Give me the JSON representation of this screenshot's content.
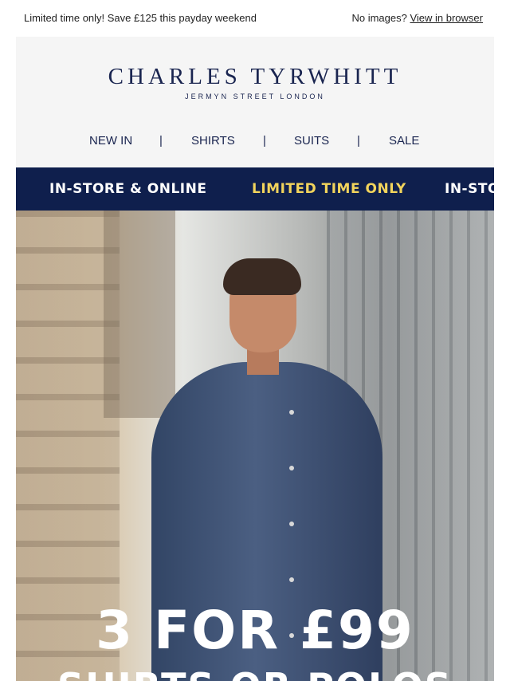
{
  "preheader": {
    "promo_text": "Limited time only! Save £125 this payday weekend",
    "no_images_text": "No images?",
    "view_in_browser_link": "View in browser"
  },
  "header": {
    "brand_name": "CHARLES TYRWHITT",
    "brand_tagline": "JERMYN STREET LONDON",
    "nav": {
      "items": [
        "NEW IN",
        "SHIRTS",
        "SUITS",
        "SALE"
      ],
      "separator": "|"
    }
  },
  "banner": {
    "messages": [
      "IN-STORE & ONLINE",
      "LIMITED TIME ONLY",
      "IN-STO"
    ],
    "colors": {
      "background": "#0f1f4d",
      "primary_text": "#ffffff",
      "highlight_text": "#f2d45c"
    }
  },
  "hero": {
    "headline": "3 FOR £99",
    "subheadline": "SHIRTS OR POLOS"
  }
}
